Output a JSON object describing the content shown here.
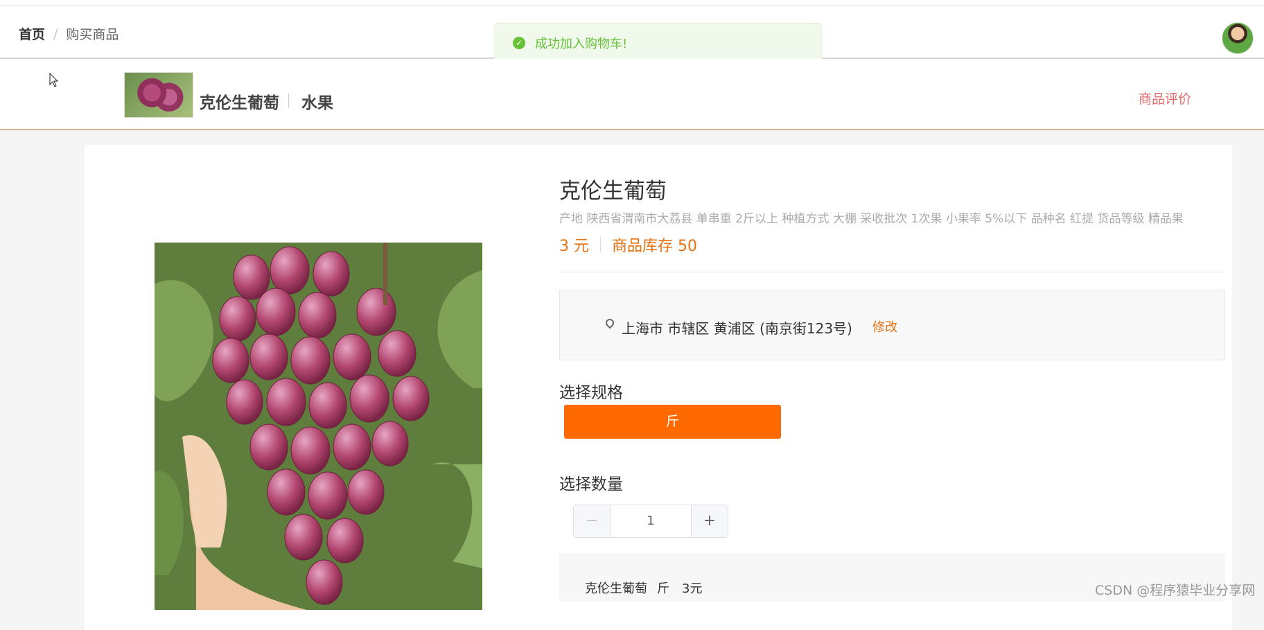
{
  "breadcrumb": {
    "home": "首页",
    "separator": "/",
    "current": "购买商品"
  },
  "toast": {
    "icon": "check-circle-icon",
    "message": "成功加入购物车!"
  },
  "product_bar": {
    "name": "克伦生葡萄",
    "category": "水果",
    "review_link": "商品评价"
  },
  "product": {
    "title": "克伦生葡萄",
    "description": "产地 陕西省渭南市大荔县 单串重 2斤以上 种植方式 大棚 采收批次 1次果 小果率 5%以下 品种名 红提 货品等级 精品果",
    "price": "3 元",
    "stock": "商品库存 50"
  },
  "address": {
    "icon": "location-pin-icon",
    "text": "上海市 市辖区 黄浦区 (南京街123号)",
    "edit_label": "修改"
  },
  "spec": {
    "label": "选择规格",
    "option": "斤"
  },
  "quantity": {
    "label": "选择数量",
    "minus": "−",
    "value": "1",
    "plus": "+"
  },
  "summary": {
    "name": "克伦生葡萄",
    "unit": "斤",
    "price": "3元"
  },
  "watermark": "CSDN @程序猿毕业分享网",
  "colors": {
    "accent": "#ff6a00",
    "price": "#e6700f",
    "success": "#67c23a",
    "review": "#e26a6a"
  }
}
